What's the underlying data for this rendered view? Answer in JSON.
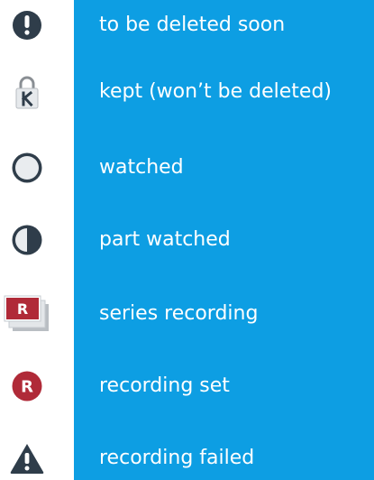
{
  "legend": {
    "items": [
      {
        "icon": "exclamation-circle-icon",
        "label": "to be deleted soon"
      },
      {
        "icon": "padlock-k-icon",
        "label": "kept (won’t be deleted)"
      },
      {
        "icon": "empty-circle-icon",
        "label": "watched"
      },
      {
        "icon": "half-filled-circle-icon",
        "label": "part watched"
      },
      {
        "icon": "stacked-r-icon",
        "label": "series recording",
        "icon_letter": "R"
      },
      {
        "icon": "r-circle-icon",
        "label": "recording set",
        "icon_letter": "R"
      },
      {
        "icon": "warning-triangle-icon",
        "label": "recording failed"
      }
    ]
  },
  "colors": {
    "label_background": "#0d9ee3",
    "label_text": "#ffffff",
    "icon_dark": "#2f3d4a",
    "recording_red": "#b02a38",
    "icon_grey": "#e9ecef"
  }
}
